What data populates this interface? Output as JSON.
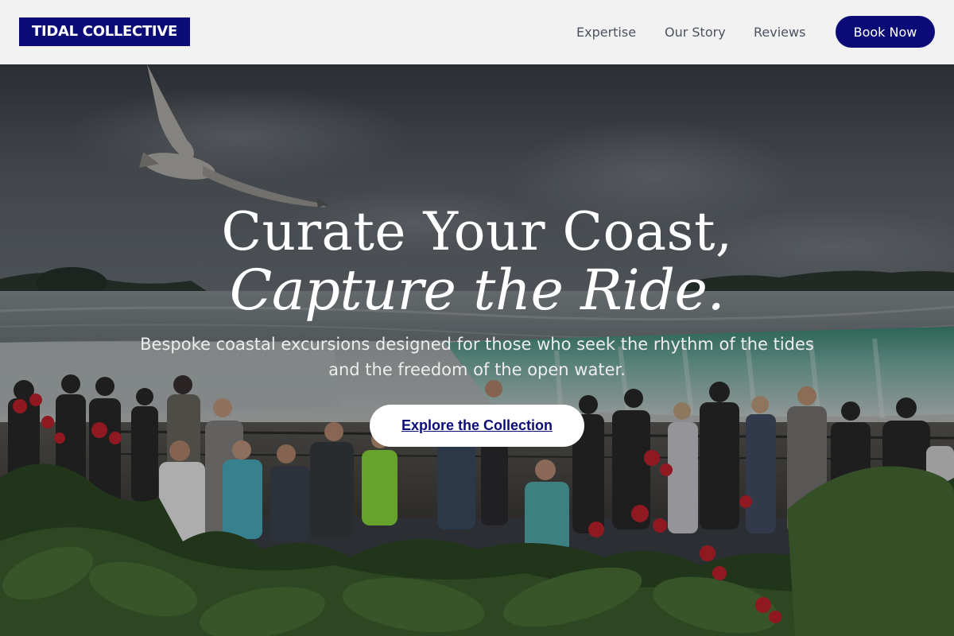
{
  "brand": {
    "name": "TIDAL COLLECTIVE"
  },
  "nav": {
    "items": [
      {
        "label": "Expertise"
      },
      {
        "label": "Our Story"
      },
      {
        "label": "Reviews"
      }
    ],
    "cta_label": "Book Now"
  },
  "hero": {
    "title_line_1": "Curate Your Coast,",
    "title_line_2": "Capture the Ride.",
    "subtitle": "Bespoke coastal excursions designed for those who seek the rhythm of the tides and the freedom of the open water.",
    "cta_label": "Explore the Collection",
    "background": "photo of waterfall viewpoint with crowd, seagull and red flowers"
  },
  "colors": {
    "brand_navy": "#0b0b78",
    "header_bg": "#f2f2f3",
    "nav_text": "#4a5260",
    "hero_text": "#ffffff"
  }
}
